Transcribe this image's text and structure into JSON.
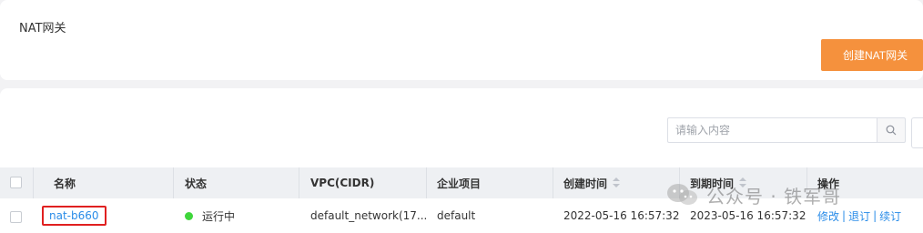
{
  "header": {
    "title": "NAT网关",
    "create_button": "创建NAT网关"
  },
  "search": {
    "placeholder": "请输入内容"
  },
  "table": {
    "columns": {
      "name": "名称",
      "status": "状态",
      "vpc": "VPC(CIDR)",
      "project": "企业项目",
      "created": "创建时间",
      "expires": "到期时间",
      "actions": "操作"
    },
    "rows": [
      {
        "name": "nat-b660",
        "status": "运行中",
        "status_color": "#3fd63b",
        "vpc": "default_network(17...",
        "project": "default",
        "created": "2022-05-16 16:57:32",
        "expires": "2023-05-16 16:57:32",
        "actions": [
          "修改",
          "退订",
          "续订"
        ]
      }
    ]
  },
  "watermark": {
    "text": "公众号 · 铁军哥",
    "icon": "wechat-icon"
  },
  "colors": {
    "accent": "#f5913d",
    "link": "#2a8ce8",
    "highlight_border": "#e02020"
  }
}
